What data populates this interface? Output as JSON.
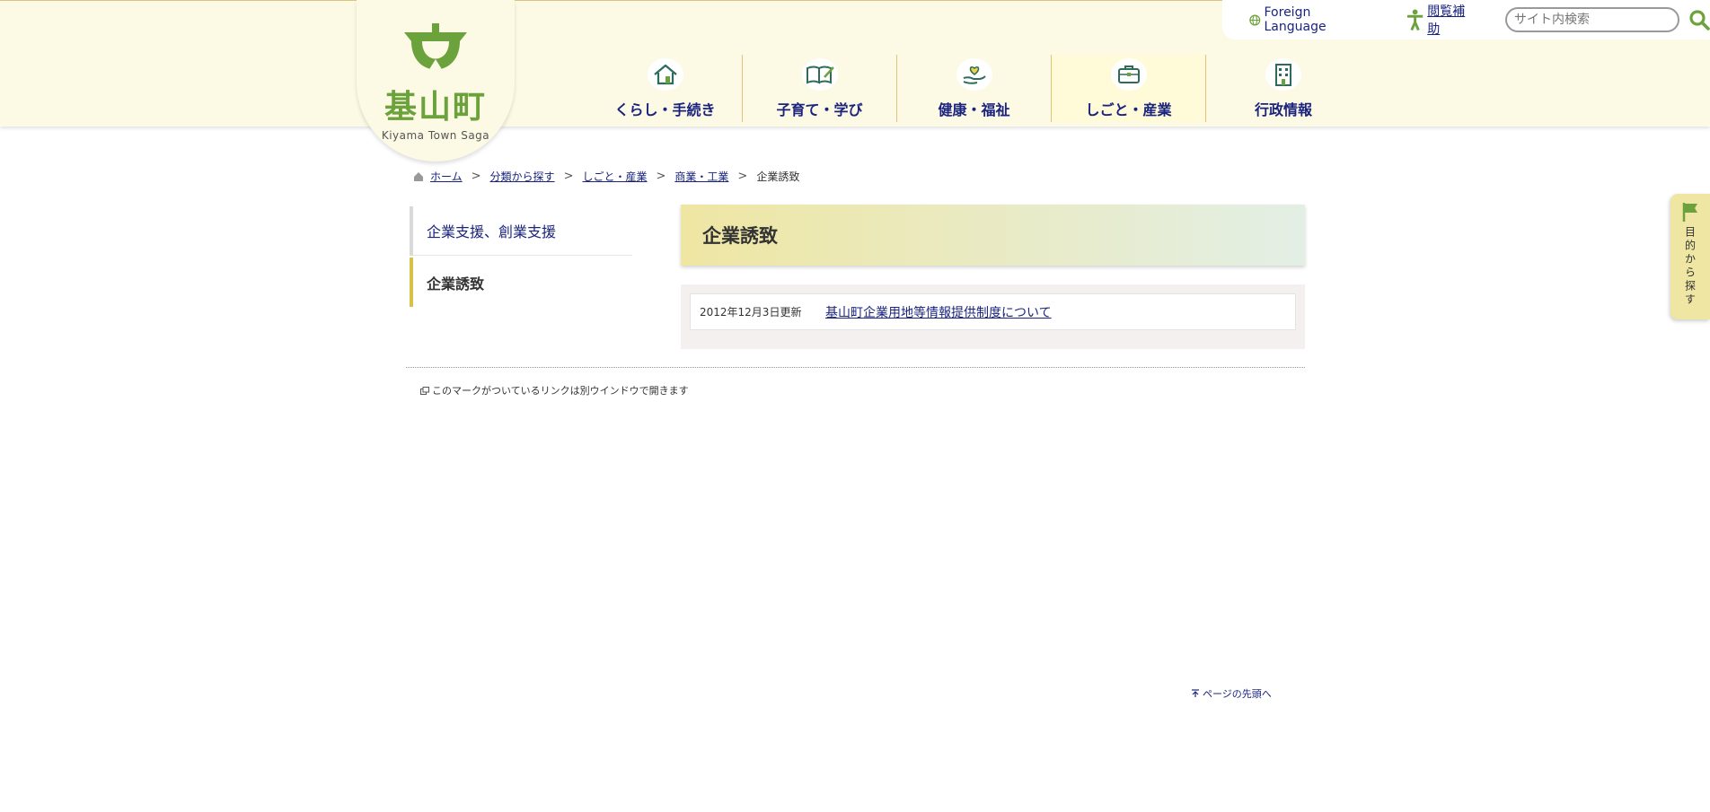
{
  "site": {
    "logo_text": "基山町",
    "logo_sub": "Kiyama Town Saga"
  },
  "utility": {
    "language_label": "Foreign Language",
    "assist_label": "閲覧補助",
    "search_placeholder": "サイト内検索"
  },
  "gnav": {
    "items": [
      {
        "label": "くらし・手続き",
        "icon": "house-icon"
      },
      {
        "label": "子育て・学び",
        "icon": "book-pen-icon"
      },
      {
        "label": "健康・福祉",
        "icon": "heart-hand-icon"
      },
      {
        "label": "しごと・産業",
        "icon": "briefcase-icon"
      },
      {
        "label": "行政情報",
        "icon": "building-icon"
      }
    ],
    "active_index": 3
  },
  "breadcrumb": {
    "items": [
      {
        "label": "ホーム"
      },
      {
        "label": "分類から探す"
      },
      {
        "label": "しごと・産業"
      },
      {
        "label": "商業・工業"
      }
    ],
    "current": "企業誘致",
    "separator": ">"
  },
  "sidenav": {
    "items": [
      {
        "label": "企業支援、創業支援"
      },
      {
        "label": "企業誘致"
      }
    ]
  },
  "main": {
    "title": "企業誘致",
    "list": [
      {
        "date": "2012年12月3日更新",
        "title": "基山町企業用地等情報提供制度について"
      }
    ],
    "new_window_note": "このマークがついているリンクは別ウインドウで開きます",
    "page_top": "ページの先頭へ"
  },
  "side_tab": {
    "label": "目的から探す"
  },
  "colors": {
    "header_bg": "#fcf9e4",
    "brand_green": "#6ca23b",
    "link_navy": "#1a237e",
    "accent_gold": "#d6c247"
  }
}
